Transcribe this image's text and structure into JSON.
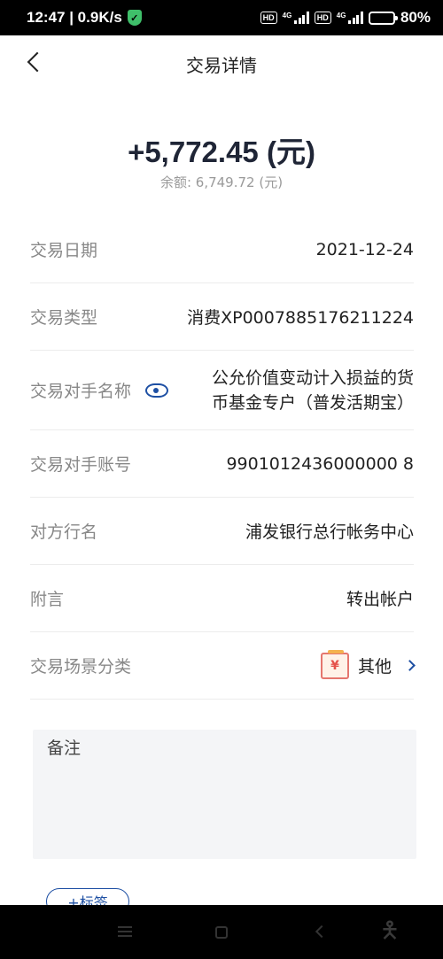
{
  "status_bar": {
    "time_speed": "12:47 | 0.9K/s",
    "hd1": "HD",
    "net1": "4G",
    "hd2": "HD",
    "net2": "4G",
    "battery_text": "80%",
    "battery_level": 0.8,
    "shield_color": "#3fbf6a"
  },
  "header": {
    "title": "交易详情",
    "back_icon": "chevron-left-icon"
  },
  "summary": {
    "amount": "+5,772.45 (元)",
    "balance": "余额: 6,749.72 (元)"
  },
  "details": [
    {
      "label": "交易日期",
      "value": "2021-12-24"
    },
    {
      "label": "交易类型",
      "value": "消费XP0007885176211224"
    },
    {
      "label": "交易对手名称",
      "value": "公允价值变动计入损益的货币基金专户（普发活期宝）"
    },
    {
      "label": "交易对手账号",
      "value": "9901012436000000 8"
    },
    {
      "label": "对方行名",
      "value": "浦发银行总行帐务中心"
    },
    {
      "label": "附言",
      "value": "转出帐户"
    },
    {
      "label": "交易场景分类",
      "value": "其他"
    }
  ],
  "memo": {
    "label": "备注"
  },
  "tag_button": {
    "label": "+标签"
  },
  "colors": {
    "accent": "#1d4fa3",
    "amount": "#1f2536"
  }
}
